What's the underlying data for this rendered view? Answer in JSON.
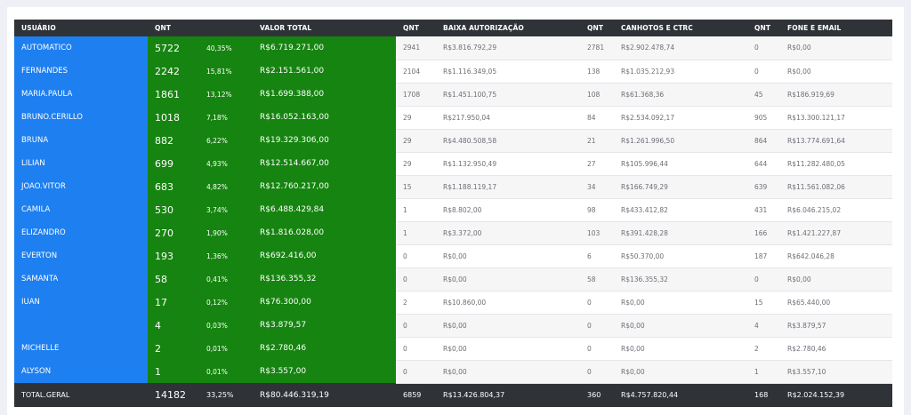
{
  "headers": {
    "usuario": "USUÁRIO",
    "qnt1": "QNT",
    "valor_total": "VALOR TOTAL",
    "qnt2": "QNT",
    "baixa": "BAIXA AUTORIZAÇÃO",
    "qnt3": "QNT",
    "canhotos": "CANHOTOS E CTRC",
    "qnt4": "QNT",
    "fone": "FONE E EMAIL"
  },
  "rows": [
    {
      "user": "AUTOMATICO",
      "qnt": "5722",
      "pct": "40,35%",
      "total": "R$6.719.271,00",
      "q2": "2941",
      "baixa": "R$3.816.792,29",
      "q3": "2781",
      "canhotos": "R$2.902.478,74",
      "q4": "0",
      "fone": "R$0,00"
    },
    {
      "user": "FERNANDES",
      "qnt": "2242",
      "pct": "15,81%",
      "total": "R$2.151.561,00",
      "q2": "2104",
      "baixa": "R$1.116.349,05",
      "q3": "138",
      "canhotos": "R$1.035.212,93",
      "q4": "0",
      "fone": "R$0,00"
    },
    {
      "user": "MARIA.PAULA",
      "qnt": "1861",
      "pct": "13,12%",
      "total": "R$1.699.388,00",
      "q2": "1708",
      "baixa": "R$1.451.100,75",
      "q3": "108",
      "canhotos": "R$61.368,36",
      "q4": "45",
      "fone": "R$186.919,69"
    },
    {
      "user": "BRUNO.CERILLO",
      "qnt": "1018",
      "pct": "7,18%",
      "total": "R$16.052.163,00",
      "q2": "29",
      "baixa": "R$217.950,04",
      "q3": "84",
      "canhotos": "R$2.534.092,17",
      "q4": "905",
      "fone": "R$13.300.121,17"
    },
    {
      "user": "BRUNA",
      "qnt": "882",
      "pct": "6,22%",
      "total": "R$19.329.306,00",
      "q2": "29",
      "baixa": "R$4.480.508,58",
      "q3": "21",
      "canhotos": "R$1.261.996,50",
      "q4": "864",
      "fone": "R$13.774.691,64"
    },
    {
      "user": "LILIAN",
      "qnt": "699",
      "pct": "4,93%",
      "total": "R$12.514.667,00",
      "q2": "29",
      "baixa": "R$1.132.950,49",
      "q3": "27",
      "canhotos": "R$105.996,44",
      "q4": "644",
      "fone": "R$11.282.480,05"
    },
    {
      "user": "JOAO.VITOR",
      "qnt": "683",
      "pct": "4,82%",
      "total": "R$12.760.217,00",
      "q2": "15",
      "baixa": "R$1.188.119,17",
      "q3": "34",
      "canhotos": "R$166.749,29",
      "q4": "639",
      "fone": "R$11.561.082,06"
    },
    {
      "user": "CAMILA",
      "qnt": "530",
      "pct": "3,74%",
      "total": "R$6.488.429,84",
      "q2": "1",
      "baixa": "R$8.802,00",
      "q3": "98",
      "canhotos": "R$433.412,82",
      "q4": "431",
      "fone": "R$6.046.215,02"
    },
    {
      "user": "ELIZANDRO",
      "qnt": "270",
      "pct": "1,90%",
      "total": "R$1.816.028,00",
      "q2": "1",
      "baixa": "R$3.372,00",
      "q3": "103",
      "canhotos": "R$391.428,28",
      "q4": "166",
      "fone": "R$1.421.227,87"
    },
    {
      "user": "EVERTON",
      "qnt": "193",
      "pct": "1,36%",
      "total": "R$692.416,00",
      "q2": "0",
      "baixa": "R$0,00",
      "q3": "6",
      "canhotos": "R$50.370,00",
      "q4": "187",
      "fone": "R$642.046,28"
    },
    {
      "user": "SAMANTA",
      "qnt": "58",
      "pct": "0,41%",
      "total": "R$136.355,32",
      "q2": "0",
      "baixa": "R$0,00",
      "q3": "58",
      "canhotos": "R$136.355,32",
      "q4": "0",
      "fone": "R$0,00"
    },
    {
      "user": "IUAN",
      "qnt": "17",
      "pct": "0,12%",
      "total": "R$76.300,00",
      "q2": "2",
      "baixa": "R$10.860,00",
      "q3": "0",
      "canhotos": "R$0,00",
      "q4": "15",
      "fone": "R$65.440,00"
    },
    {
      "user": "",
      "qnt": "4",
      "pct": "0,03%",
      "total": "R$3.879,57",
      "q2": "0",
      "baixa": "R$0,00",
      "q3": "0",
      "canhotos": "R$0,00",
      "q4": "4",
      "fone": "R$3.879,57"
    },
    {
      "user": "MICHELLE",
      "qnt": "2",
      "pct": "0,01%",
      "total": "R$2.780,46",
      "q2": "0",
      "baixa": "R$0,00",
      "q3": "0",
      "canhotos": "R$0,00",
      "q4": "2",
      "fone": "R$2.780,46"
    },
    {
      "user": "ALYSON",
      "qnt": "1",
      "pct": "0,01%",
      "total": "R$3.557,00",
      "q2": "0",
      "baixa": "R$0,00",
      "q3": "0",
      "canhotos": "R$0,00",
      "q4": "1",
      "fone": "R$3.557,10"
    }
  ],
  "total": {
    "user": "TOTAL.GERAL",
    "qnt": "14182",
    "pct": "33,25%",
    "total": "R$80.446.319,19",
    "q2": "6859",
    "baixa": "R$13.426.804,37",
    "q3": "360",
    "canhotos": "R$4.757.820,44",
    "q4": "168",
    "fone": "R$2.024.152,39"
  },
  "colors": {
    "header_bg": "#2f3338",
    "user_column": "#1e7ff0",
    "green_block": "#168410"
  }
}
